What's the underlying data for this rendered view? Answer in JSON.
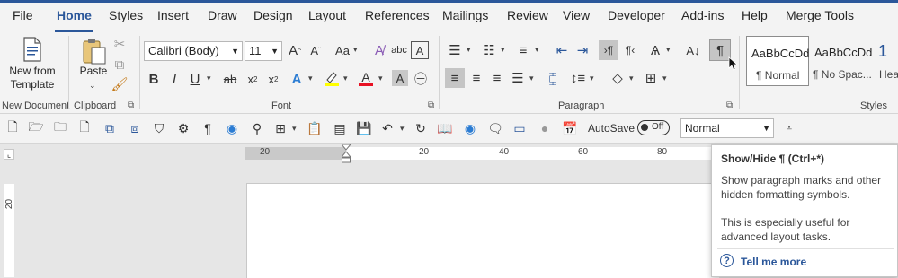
{
  "tabs": [
    "File",
    "Home",
    "Styles",
    "Insert",
    "Draw",
    "Design",
    "Layout",
    "References",
    "Mailings",
    "Review",
    "View",
    "Developer",
    "Add-ins",
    "Help",
    "Merge Tools"
  ],
  "active_tab": "Home",
  "ribbon": {
    "new_document": {
      "button_label": "New from Template",
      "group_label": "New Document"
    },
    "clipboard": {
      "paste_label": "Paste",
      "group_label": "Clipboard"
    },
    "font": {
      "font_name": "Calibri (Body)",
      "font_size": "11",
      "group_label": "Font"
    },
    "paragraph": {
      "group_label": "Paragraph"
    },
    "styles": {
      "group_label": "Styles",
      "items": [
        {
          "preview": "AaBbCcDd",
          "name": "¶ Normal"
        },
        {
          "preview": "AaBbCcDd",
          "name": "¶ No Spac..."
        },
        {
          "preview": "1",
          "name": "Hea"
        }
      ]
    }
  },
  "qat": {
    "autosave_label": "AutoSave",
    "autosave_state": "Off",
    "style_value": "Normal"
  },
  "ruler": {
    "numbers": [
      "20",
      "20",
      "40",
      "60",
      "80"
    ],
    "vertical_number": "20"
  },
  "tooltip": {
    "title": "Show/Hide ¶ (Ctrl+*)",
    "description": "Show paragraph marks and other hidden formatting symbols.",
    "extra": "This is especially useful for advanced layout tasks.",
    "link": "Tell me more"
  },
  "colors": {
    "accent": "#2b579a",
    "font_color": "#e81123",
    "highlight": "#ffff00"
  }
}
